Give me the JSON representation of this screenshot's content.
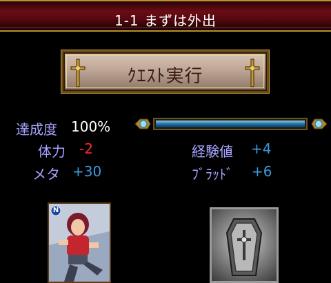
{
  "header": {
    "title": "1-1 まずは外出"
  },
  "quest_button": {
    "label": "ｸｴｽﾄ実行"
  },
  "stats": {
    "achievement_label": "達成度",
    "achievement_value": "100%",
    "achievement_progress": 1.0,
    "stamina_label": "体力",
    "stamina_value": "-2",
    "exp_label": "経験値",
    "exp_value": "+4",
    "meta_label": "メタ",
    "meta_value": "+30",
    "blood_label": "ﾌﾞﾗｯﾄﾞ",
    "blood_value": "+6"
  },
  "card": {
    "rarity_badge": "N"
  },
  "colors": {
    "label": "#a6a2ff",
    "negative": "#ff2a2a",
    "positive": "#3c9ae0",
    "gauge": "#3c9ae0"
  },
  "icons": {
    "cross": "ornate-cross-icon",
    "gem": "jewel-icon",
    "coffin": "coffin-icon"
  }
}
